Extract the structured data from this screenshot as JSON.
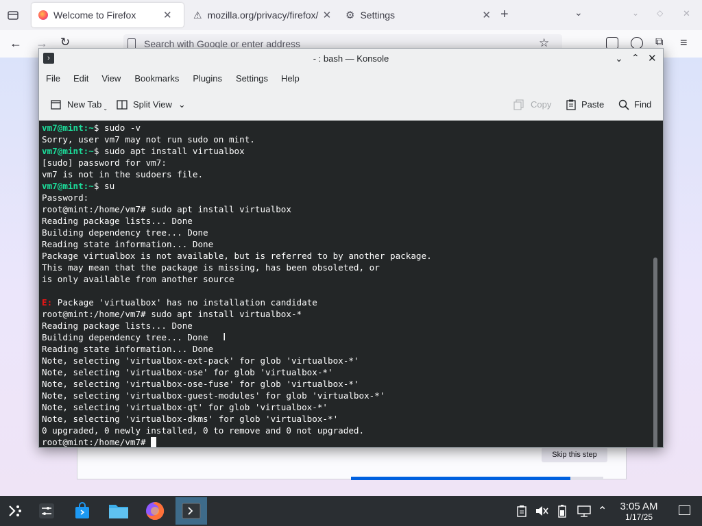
{
  "firefox": {
    "tabs": [
      {
        "title": "Welcome to Firefox",
        "active": true
      },
      {
        "title": "mozilla.org/privacy/firefox/",
        "active": false
      },
      {
        "title": "Settings",
        "active": false
      }
    ],
    "new_tab_label": "+",
    "url_placeholder": "Search with Google or enter address",
    "onboarding": {
      "skip_label": "Skip this step",
      "progress": 0.87
    }
  },
  "konsole": {
    "title": "- : bash — Konsole",
    "menu": [
      "File",
      "Edit",
      "View",
      "Bookmarks",
      "Plugins",
      "Settings",
      "Help"
    ],
    "toolbar": {
      "new_tab": "New Tab",
      "split_view": "Split View",
      "copy": "Copy",
      "paste": "Paste",
      "find": "Find"
    },
    "terminal": {
      "lines": [
        {
          "user": "vm7@mint",
          "path": ":~",
          "cmd": "$ sudo -v"
        },
        {
          "text": "Sorry, user vm7 may not run sudo on mint."
        },
        {
          "user": "vm7@mint",
          "path": ":~",
          "cmd": "$ sudo apt install virtualbox"
        },
        {
          "text": "[sudo] password for vm7:"
        },
        {
          "text": "vm7 is not in the sudoers file."
        },
        {
          "user": "vm7@mint",
          "path": ":~",
          "cmd": "$ su"
        },
        {
          "text": "Password:"
        },
        {
          "text": "root@mint:/home/vm7# sudo apt install virtualbox"
        },
        {
          "text": "Reading package lists... Done"
        },
        {
          "text": "Building dependency tree... Done"
        },
        {
          "text": "Reading state information... Done"
        },
        {
          "text": "Package virtualbox is not available, but is referred to by another package."
        },
        {
          "text": "This may mean that the package is missing, has been obsoleted, or"
        },
        {
          "text": "is only available from another source"
        },
        {
          "text": ""
        },
        {
          "err": "E:",
          "text": " Package 'virtualbox' has no installation candidate"
        },
        {
          "text": "root@mint:/home/vm7# sudo apt install virtualbox-*"
        },
        {
          "text": "Reading package lists... Done"
        },
        {
          "text": "Building dependency tree... Done"
        },
        {
          "text": "Reading state information... Done"
        },
        {
          "text": "Note, selecting 'virtualbox-ext-pack' for glob 'virtualbox-*'"
        },
        {
          "text": "Note, selecting 'virtualbox-ose' for glob 'virtualbox-*'"
        },
        {
          "text": "Note, selecting 'virtualbox-ose-fuse' for glob 'virtualbox-*'"
        },
        {
          "text": "Note, selecting 'virtualbox-guest-modules' for glob 'virtualbox-*'"
        },
        {
          "text": "Note, selecting 'virtualbox-qt' for glob 'virtualbox-*'"
        },
        {
          "text": "Note, selecting 'virtualbox-dkms' for glob 'virtualbox-*'"
        },
        {
          "text": "0 upgraded, 0 newly installed, 0 to remove and 0 not upgraded."
        },
        {
          "text": "root@mint:/home/vm7# ",
          "cursor": true
        }
      ]
    }
  },
  "taskbar": {
    "clock_time": "3:05 AM",
    "clock_date": "1/17/25",
    "apps": [
      "application-launcher-icon",
      "settings-sliders-icon",
      "store-bag-icon",
      "file-manager-icon",
      "firefox-icon",
      "konsole-icon"
    ],
    "tray": [
      "clipboard-icon",
      "volume-muted-icon",
      "battery-icon",
      "network-icon",
      "tray-expand-icon",
      "show-desktop-icon"
    ]
  },
  "colors": {
    "terminal_bg": "#232627",
    "prompt_user": "#1cdc9a",
    "error_red": "#ed1515",
    "progress_blue": "#0060df"
  }
}
